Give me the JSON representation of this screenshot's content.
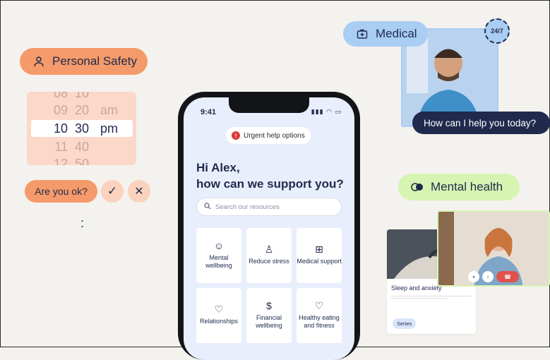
{
  "pills": {
    "safety": {
      "label": "Personal Safety",
      "icon": "person-icon"
    },
    "medical": {
      "label": "Medical",
      "icon": "medical-bag-icon"
    },
    "mental": {
      "label": "Mental health",
      "icon": "mental-health-icon"
    }
  },
  "time_picker": {
    "rows": [
      {
        "h": "08",
        "m": "10",
        "ap": ""
      },
      {
        "h": "09",
        "m": "20",
        "ap": "am"
      },
      {
        "h": "10",
        "m": "30",
        "ap": "pm"
      },
      {
        "h": "11",
        "m": "40",
        "ap": ""
      },
      {
        "h": "12",
        "m": "50",
        "ap": ""
      }
    ]
  },
  "checkin": {
    "label": "Are you ok?",
    "check": "✓",
    "close": "✕"
  },
  "colon": ":",
  "phone": {
    "time": "9:41",
    "status": "▮▮▮ ◠ ▭",
    "urgent_label": "Urgent help options",
    "urgent_icon": "!",
    "greeting_line1": "Hi Alex,",
    "greeting_line2": "how can we support you?",
    "search_placeholder": "Search our resources",
    "tiles": [
      {
        "icon": "☺",
        "label": "Mental wellbeing"
      },
      {
        "icon": "♙",
        "label": "Reduce stress"
      },
      {
        "icon": "⊞",
        "label": "Medical support"
      },
      {
        "icon": "♡",
        "label": "Relationships"
      },
      {
        "icon": "$",
        "label": "Financial wellbeing"
      },
      {
        "icon": "♡",
        "label": "Healthy eating and fitness"
      }
    ]
  },
  "badge": "24/7",
  "chat_bubble": "How can I help you today?",
  "card": {
    "caption": "Sleep and anxiety",
    "series": "Series"
  },
  "colors": {
    "orange": "#f59a6a",
    "blue": "#a9cdf3",
    "green": "#d6f4b2",
    "navy": "#1f2a4d"
  }
}
